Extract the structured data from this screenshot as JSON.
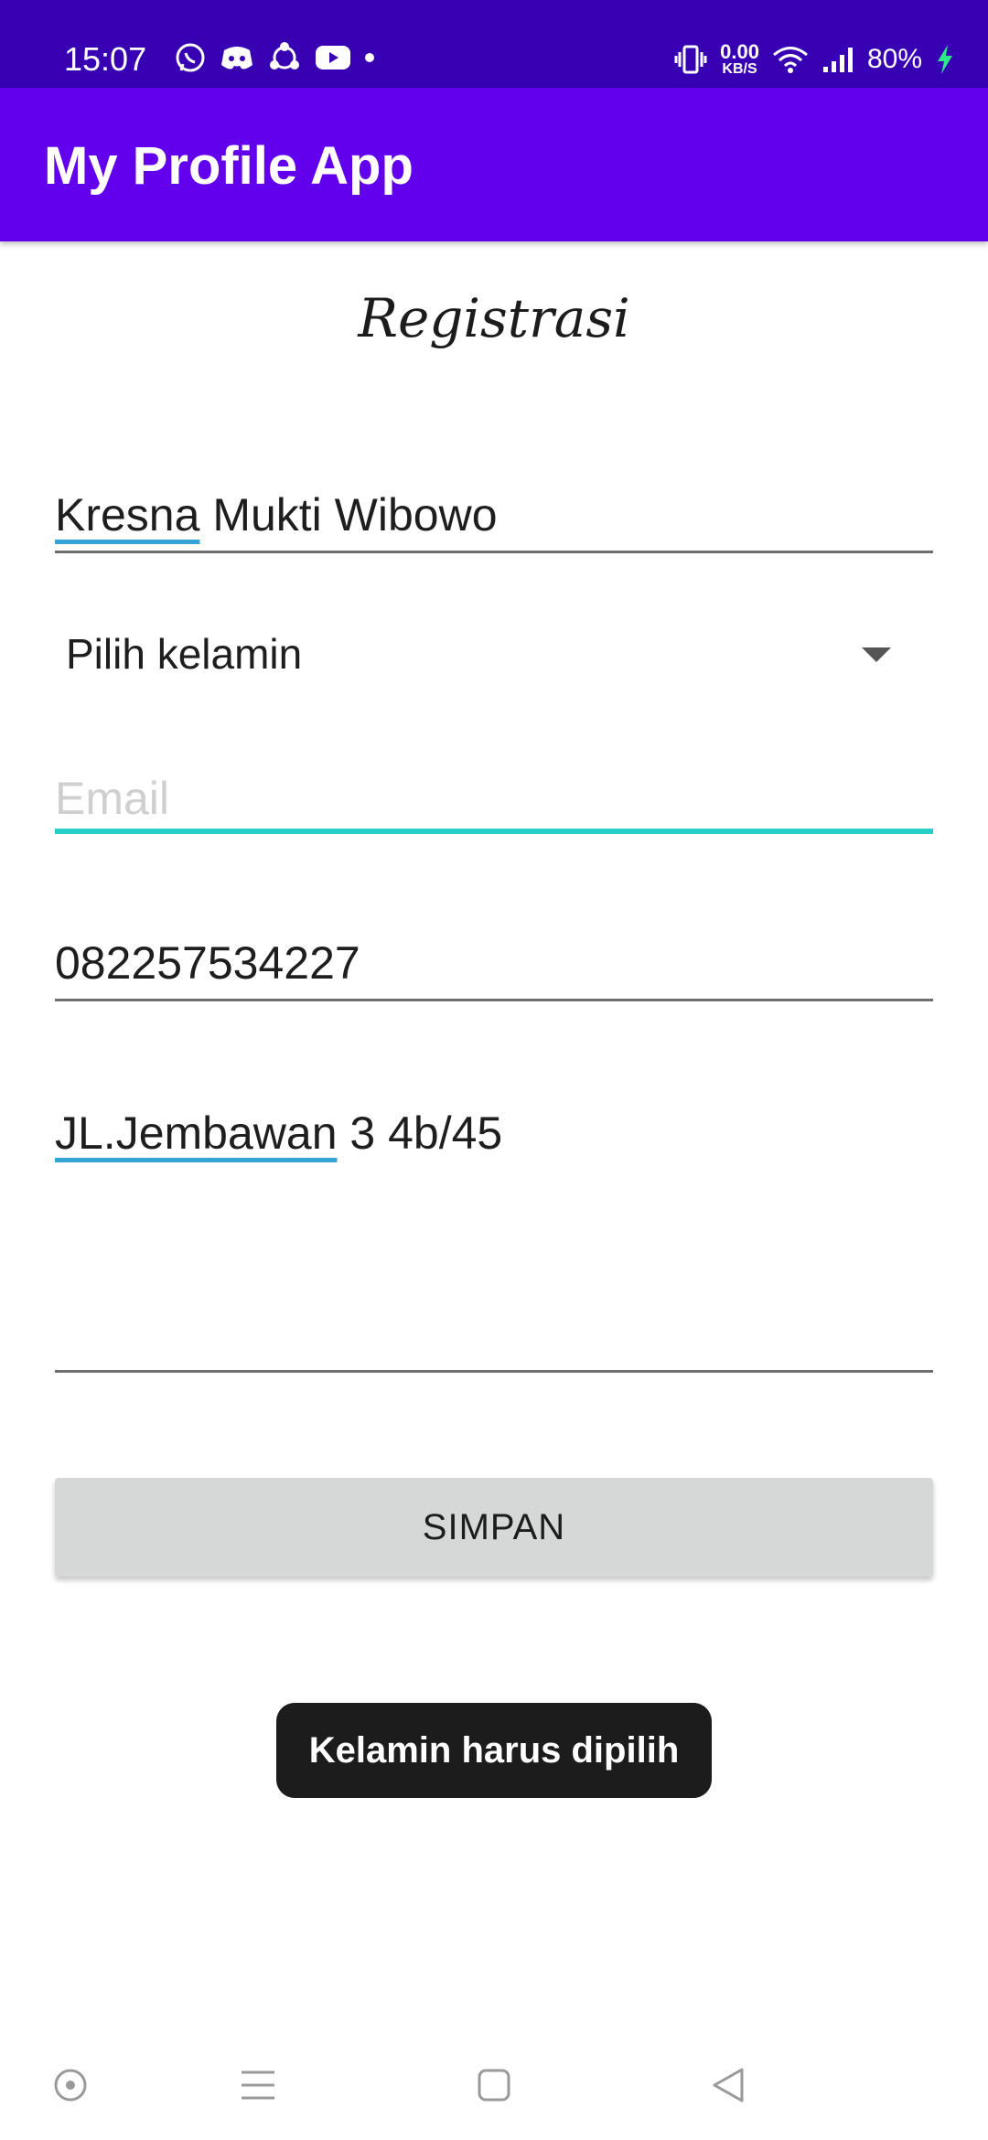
{
  "status_bar": {
    "time": "15:07",
    "left_icons": [
      "whatsapp-icon",
      "discord-icon",
      "share-icon",
      "youtube-icon",
      "dot-icon"
    ],
    "net_speed_value": "0.00",
    "net_speed_unit": "KB/S",
    "battery": "80%",
    "right_icons": [
      "vibrate-icon",
      "wifi-icon",
      "signal-icon",
      "charging-icon"
    ]
  },
  "app_bar": {
    "title": "My Profile App"
  },
  "form": {
    "heading": "Registrasi",
    "name_first": "Kresna",
    "name_rest": " Mukti Wibowo",
    "gender_selected": "Pilih kelamin",
    "email_placeholder": "Email",
    "email_value": "",
    "phone_value": "082257534227",
    "address_first": "JL.Jembawan",
    "address_rest": " 3 4b/45",
    "save_label": "SIMPAN"
  },
  "toast": {
    "message": "Kelamin harus dipilih"
  },
  "nav_bar": {
    "buttons": [
      "assistant-icon",
      "recents-icon",
      "home-icon",
      "back-icon"
    ]
  },
  "colors": {
    "status_bar": "#3700b3",
    "app_bar": "#6200ee",
    "focus_underline": "#26d0c6",
    "spellcheck_underline": "#34a4d4",
    "button_bg": "#d6d7d7",
    "toast_bg": "#1c1c1c"
  }
}
